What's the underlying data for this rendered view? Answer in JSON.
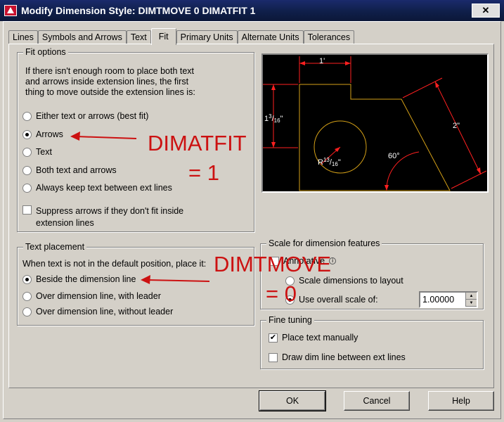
{
  "window": {
    "title": "Modify Dimension Style: DIMTMOVE 0 DIMATFIT 1",
    "close_glyph": "✕"
  },
  "tabs": [
    {
      "label": "Lines"
    },
    {
      "label": "Symbols and Arrows"
    },
    {
      "label": "Text"
    },
    {
      "label": "Fit",
      "active": true
    },
    {
      "label": "Primary Units"
    },
    {
      "label": "Alternate Units"
    },
    {
      "label": "Tolerances"
    }
  ],
  "fit_options": {
    "title": "Fit options",
    "description": "If there isn't enough room to place both text and arrows inside extension lines, the first thing to move outside the extension lines is:",
    "options": [
      {
        "label": "Either text or arrows (best fit)",
        "selected": false
      },
      {
        "label": "Arrows",
        "selected": true
      },
      {
        "label": "Text",
        "selected": false
      },
      {
        "label": "Both text and arrows",
        "selected": false
      },
      {
        "label": "Always keep text between ext lines",
        "selected": false
      }
    ],
    "suppress_label_1": "Suppress arrows if they don't fit inside",
    "suppress_label_2": "extension lines",
    "suppress_checked": false
  },
  "text_placement": {
    "title": "Text placement",
    "description": "When text is not in the default position, place it:",
    "options": [
      {
        "label": "Beside the dimension line",
        "selected": true
      },
      {
        "label": "Over dimension line, with leader",
        "selected": false
      },
      {
        "label": "Over dimension line, without leader",
        "selected": false
      }
    ]
  },
  "preview": {
    "dim_top": "1'",
    "dim_left_whole": "1",
    "dim_left_num": "3",
    "dim_left_den": "16",
    "dim_left_tick": "\"",
    "dim_right": "2\"",
    "dim_angle": "60°",
    "dim_radius_prefix": "R",
    "dim_radius_num": "13",
    "dim_radius_den": "16",
    "dim_radius_tick": "\"",
    "colors": {
      "background": "#000000",
      "geometry": "#d4a017",
      "dimensions": "#ff2020",
      "text": "#ffffff"
    }
  },
  "scale": {
    "title": "Scale for dimension features",
    "annotative_label": "Annotative",
    "scale_to_layout_label": "Scale dimensions to layout",
    "overall_scale_label": "Use overall scale of:",
    "overall_scale_value": "1.00000",
    "overall_selected": true
  },
  "fine_tuning": {
    "title": "Fine tuning",
    "place_text_manually_label": "Place text manually",
    "place_text_manually_checked": true,
    "draw_dim_line_label": "Draw dim line between ext lines",
    "draw_dim_line_checked": false,
    "check_glyph": "✔"
  },
  "buttons": {
    "ok": "OK",
    "cancel": "Cancel",
    "help": "Help"
  },
  "annotations": {
    "dimatfit_label": "DIMATFIT",
    "dimatfit_value": "= 1",
    "dimtmove_label": "DIMTMOVE",
    "dimtmove_value": "= 0",
    "color": "#cc1111"
  }
}
